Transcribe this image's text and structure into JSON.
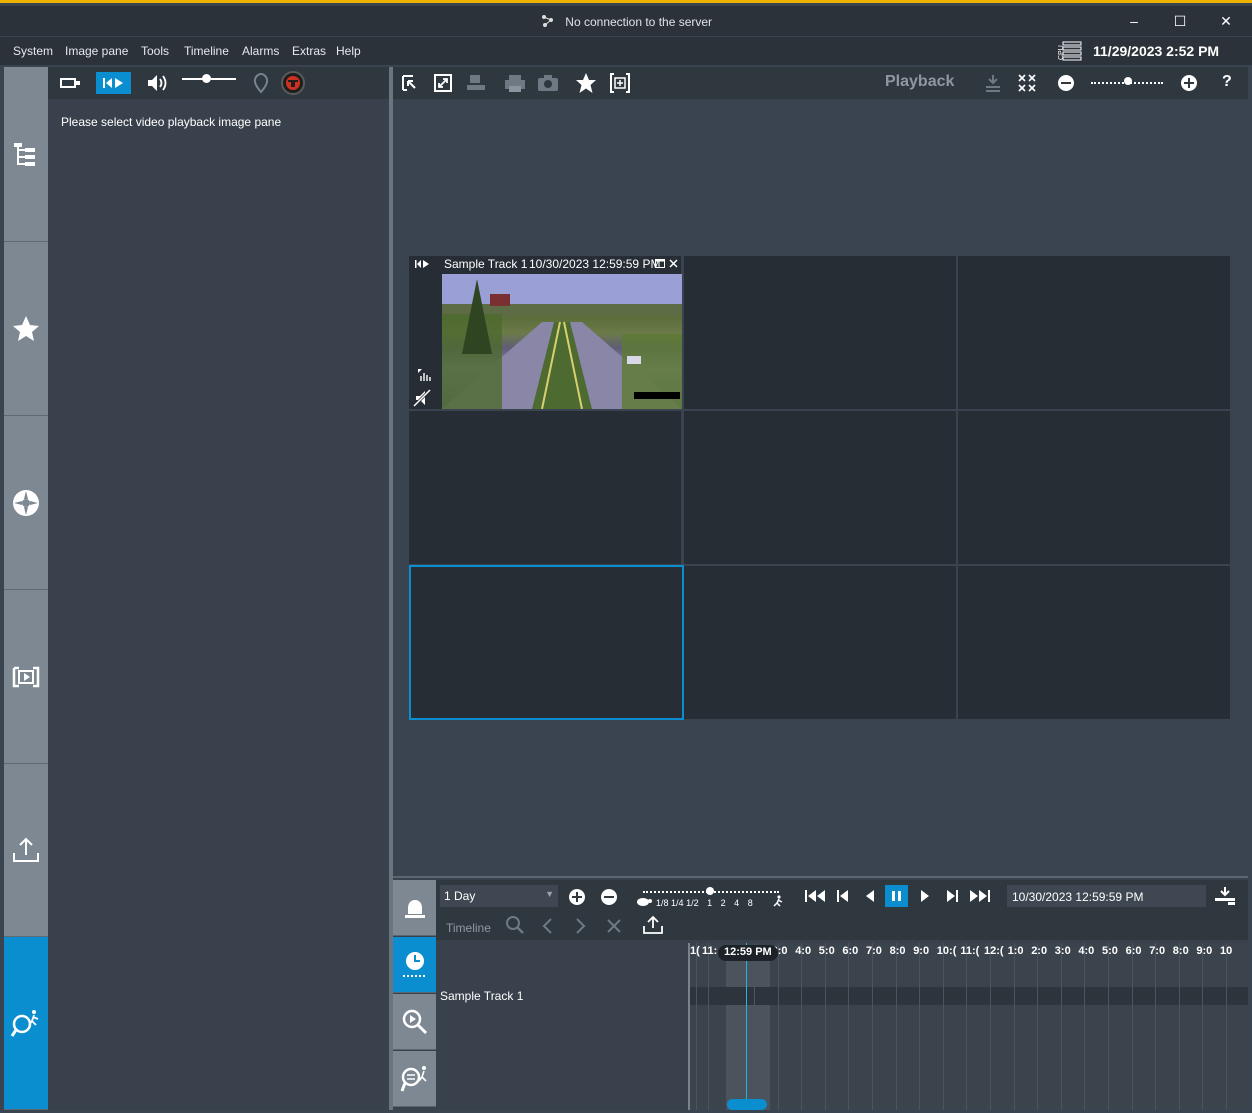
{
  "titlebar": {
    "title": "No connection to the server",
    "minimize": "–",
    "maximize": "☐",
    "close": "✕"
  },
  "menu": {
    "items": [
      "System",
      "Image pane",
      "Tools",
      "Timeline",
      "Alarms",
      "Extras",
      "Help"
    ],
    "cpu_label": "CPU",
    "datetime": "11/29/2023 2:52 PM"
  },
  "left_panel": {
    "message": "Please select video playback image pane"
  },
  "image_toolbar": {
    "mode_label": "Playback",
    "help": "?"
  },
  "image_grid": {
    "pane1": {
      "title": "Sample Track 1",
      "timestamp": "10/30/2023 12:59:59 PM"
    }
  },
  "timeline": {
    "range_value": "1 Day",
    "speed_labels": [
      "1/8",
      "1/4",
      "1/2",
      "1",
      "2",
      "4",
      "8"
    ],
    "current_time": "10/30/2023 12:59:59 PM",
    "label": "Timeline",
    "track_name": "Sample Track 1",
    "now_label": "12:59 PM",
    "hour_ticks": [
      "1(",
      "11:",
      "2:0",
      "3:0",
      "4:0",
      "5:0",
      "6:0",
      "7:0",
      "8:0",
      "9:0",
      "10:(",
      "11:(",
      "12:(",
      "1:0",
      "2:0",
      "3:0",
      "4:0",
      "5:0",
      "6:0",
      "7:0",
      "8:0",
      "9:0",
      "10"
    ]
  },
  "colors": {
    "accent": "#0b8ed0",
    "title_stripe": "#f0b400",
    "background": "#3a4450"
  }
}
